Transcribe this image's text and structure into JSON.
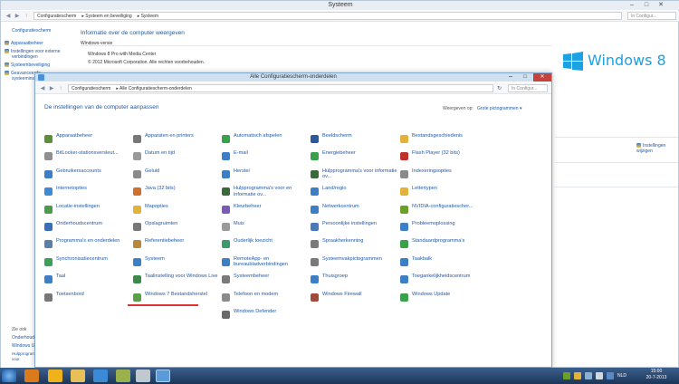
{
  "bg_window": {
    "title": "Systeem",
    "controls": [
      "–",
      "□",
      "✕"
    ],
    "breadcrumbs": [
      "Configuratiescherm",
      "Systeem en beveiliging",
      "Systeem"
    ],
    "search_placeholder": "In Configur...",
    "sidebar": {
      "home": "Configuratiescherm",
      "links": [
        "Apparaatbeheer",
        "Instellingen voor externe verbindingen",
        "Systeembeveiliging",
        "Geavanceerde systeeminst..."
      ],
      "see_also_title": "Zie ook",
      "see_also": [
        "Onderhoudsc...",
        "Windows Upd...",
        "Hulpprogramma's voor prestatie-informatie en..."
      ]
    },
    "main": {
      "heading": "Informatie over de computer weergeven",
      "edition_label": "Windows-versie",
      "edition": "Windows 8 Pro with Media Center",
      "copyright": "© 2012 Microsoft Corporation. Alle rechten voorbehouden.",
      "logo_text": "Windows 8",
      "change_settings": "Instellingen wijzigen"
    }
  },
  "main_window": {
    "title": "Alle Configuratiescherm-onderdelen",
    "breadcrumbs": [
      "Configuratiescherm",
      "Alle Configuratiescherm-onderdelen"
    ],
    "search_placeholder": "In Configur...",
    "heading": "De instellingen van de computer aanpassen",
    "view_by_label": "Weergeven op:",
    "view_by_value": "Grote pictogrammen ▾",
    "columns": [
      [
        {
          "label": "Apparaatbeheer",
          "icon": "device-manager-icon",
          "color": "#5c8f3a"
        },
        {
          "label": "BitLocker-stationsversleut...",
          "icon": "bitlocker-icon",
          "color": "#8f8f8f"
        },
        {
          "label": "Gebruikersaccounts",
          "icon": "user-accounts-icon",
          "color": "#3c7fc4"
        },
        {
          "label": "Internetopties",
          "icon": "internet-options-icon",
          "color": "#3d8bd6"
        },
        {
          "label": "Locatie-instellingen",
          "icon": "location-icon",
          "color": "#4a9b4a"
        },
        {
          "label": "Onderhoudscentrum",
          "icon": "action-center-icon",
          "color": "#3a6fb5"
        },
        {
          "label": "Programma's en onderdelen",
          "icon": "programs-icon",
          "color": "#5a7fa8"
        },
        {
          "label": "Synchronisatiecentrum",
          "icon": "sync-center-icon",
          "color": "#3aa05a"
        },
        {
          "label": "Taal",
          "icon": "language-icon",
          "color": "#3c7fc4"
        },
        {
          "label": "Toetsenbord",
          "icon": "keyboard-icon",
          "color": "#777"
        }
      ],
      [
        {
          "label": "Apparaten en printers",
          "icon": "devices-printers-icon",
          "color": "#777"
        },
        {
          "label": "Datum en tijd",
          "icon": "date-time-icon",
          "color": "#9a9a9a"
        },
        {
          "label": "Geluid",
          "icon": "sound-icon",
          "color": "#8a8a8a"
        },
        {
          "label": "Java (32 bits)",
          "icon": "java-icon",
          "color": "#d0702a"
        },
        {
          "label": "Mapopties",
          "icon": "folder-options-icon",
          "color": "#e3b23c"
        },
        {
          "label": "Opslagruimten",
          "icon": "storage-spaces-icon",
          "color": "#777"
        },
        {
          "label": "Referentiebeheer",
          "icon": "credential-manager-icon",
          "color": "#b8873a"
        },
        {
          "label": "Systeem",
          "icon": "system-icon",
          "color": "#3c7fc4"
        },
        {
          "label": "Taalinstelling voor Windows Live",
          "icon": "windows-live-icon",
          "color": "#3a8a4a"
        },
        {
          "label": "Windows 7 Bestandsherstel",
          "icon": "file-recovery-icon",
          "color": "#5aa04a"
        }
      ],
      [
        {
          "label": "Automatisch afspelen",
          "icon": "autoplay-icon",
          "color": "#3aa04a"
        },
        {
          "label": "E-mail",
          "icon": "mail-icon",
          "color": "#3c7fc4"
        },
        {
          "label": "Herstel",
          "icon": "recovery-icon",
          "color": "#3c7fc4"
        },
        {
          "label": "Hulpprogramma's voor en informatie ov...",
          "icon": "performance-icon",
          "color": "#3a6a3a"
        },
        {
          "label": "Kleurbeheer",
          "icon": "color-management-icon",
          "color": "#7a5ab8"
        },
        {
          "label": "Muis",
          "icon": "mouse-icon",
          "color": "#9a9a9a"
        },
        {
          "label": "Ouderlijk toezicht",
          "icon": "parental-controls-icon",
          "color": "#3a9a6a"
        },
        {
          "label": "RemoteApp- en bureaubladverbindingen",
          "icon": "remoteapp-icon",
          "color": "#3c7fc4"
        },
        {
          "label": "Systeembeheer",
          "icon": "admin-tools-icon",
          "color": "#7a7a7a"
        },
        {
          "label": "Telefoon en modem",
          "icon": "phone-modem-icon",
          "color": "#8a8a8a"
        },
        {
          "label": "Windows Defender",
          "icon": "defender-icon",
          "color": "#6a6a6a"
        }
      ],
      [
        {
          "label": "Beeldscherm",
          "icon": "display-icon",
          "color": "#2a5a9a"
        },
        {
          "label": "Energiebeheer",
          "icon": "power-icon",
          "color": "#3aa04a"
        },
        {
          "label": "Hulpprogramma's voor informatie ov...",
          "icon": "perf-info-icon",
          "color": "#3a6a3a"
        },
        {
          "label": "Land/regio",
          "icon": "region-icon",
          "color": "#3c7fc4"
        },
        {
          "label": "Netwerkcentrum",
          "icon": "network-center-icon",
          "color": "#3c7fc4"
        },
        {
          "label": "Persoonlijke instellingen",
          "icon": "personalization-icon",
          "color": "#4a7ab8"
        },
        {
          "label": "Spraakherkenning",
          "icon": "speech-icon",
          "color": "#7a7a7a"
        },
        {
          "label": "Systeemvakpictogrammen",
          "icon": "tray-icons-icon",
          "color": "#7a7a7a"
        },
        {
          "label": "Thuisgroep",
          "icon": "homegroup-icon",
          "color": "#3c7fc4"
        },
        {
          "label": "Windows Firewall",
          "icon": "firewall-icon",
          "color": "#a04a3a"
        }
      ],
      [
        {
          "label": "Bestandsgeschiedenis",
          "icon": "file-history-icon",
          "color": "#e3b23c"
        },
        {
          "label": "Flash Player (32 bits)",
          "icon": "flash-icon",
          "color": "#c0302a"
        },
        {
          "label": "Indexeringsopties",
          "icon": "indexing-icon",
          "color": "#8a8a8a"
        },
        {
          "label": "Lettertypen",
          "icon": "fonts-icon",
          "color": "#e3b23c"
        },
        {
          "label": "NVIDIA-configuratiescher...",
          "icon": "nvidia-icon",
          "color": "#6aa02a"
        },
        {
          "label": "Probleemoplossing",
          "icon": "troubleshooting-icon",
          "color": "#3c7fc4"
        },
        {
          "label": "Standaardprogramma's",
          "icon": "default-programs-icon",
          "color": "#3aa04a"
        },
        {
          "label": "Taakbalk",
          "icon": "taskbar-icon",
          "color": "#3c7fc4"
        },
        {
          "label": "Toegankelijkheidscentrum",
          "icon": "ease-of-access-icon",
          "color": "#3c7fc4"
        },
        {
          "label": "Windows Update",
          "icon": "windows-update-icon",
          "color": "#3aa04a"
        }
      ]
    ]
  },
  "taskbar": {
    "time": "15:00",
    "date": "20-7-2013",
    "lang": "NLD"
  }
}
